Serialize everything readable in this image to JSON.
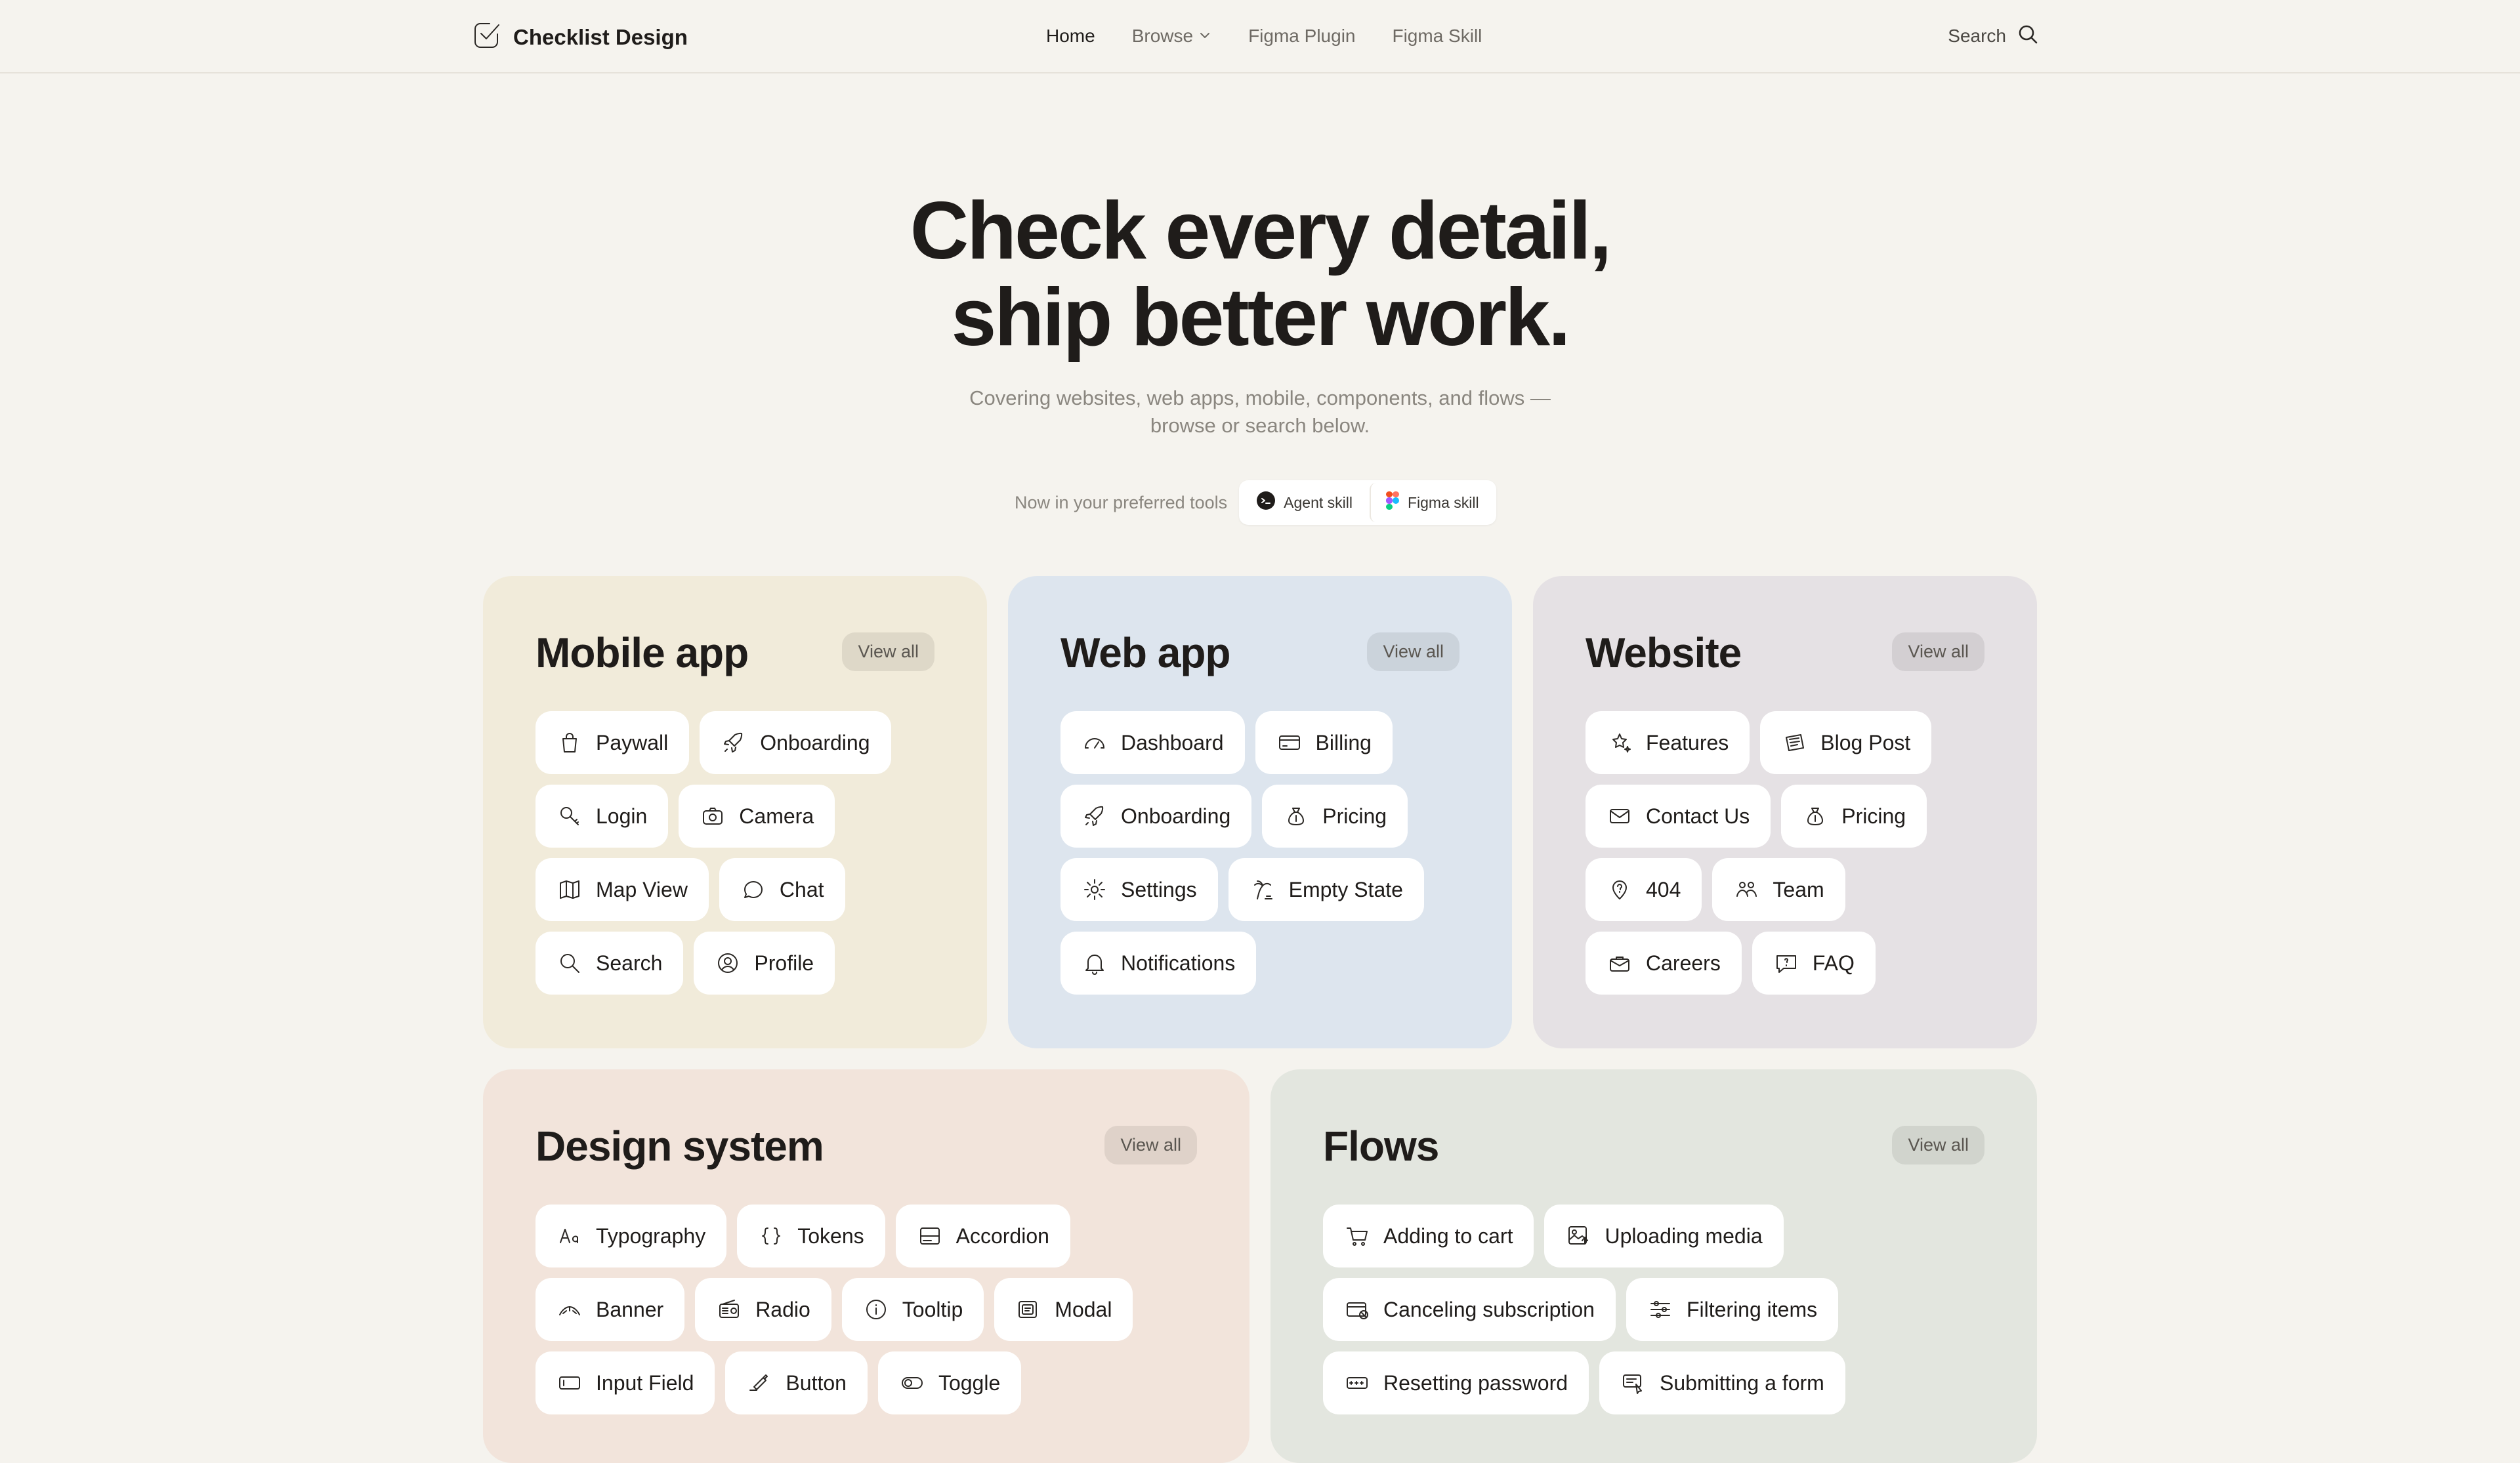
{
  "header": {
    "brand": "Checklist Design",
    "nav": [
      "Home",
      "Browse",
      "Figma Plugin",
      "Figma Skill"
    ],
    "search_label": "Search"
  },
  "hero": {
    "title_line1": "Check every detail,",
    "title_line2": "ship better work.",
    "subtitle_line1": "Covering websites, web apps, mobile, components, and flows —",
    "subtitle_line2": "browse or search below.",
    "tools_label": "Now in your preferred tools",
    "tools": [
      "Agent skill",
      "Figma skill"
    ]
  },
  "colors": {
    "background": "#f5f3ee",
    "mobile": "#f1ebda",
    "web": "#dde5ee",
    "website": "#e5e1e4",
    "design": "#f2e4db",
    "flows": "#e3e6df"
  },
  "cards": {
    "mobile": {
      "title": "Mobile app",
      "view_all": "View all",
      "rows": [
        [
          {
            "label": "Paywall",
            "icon": "bag-icon"
          },
          {
            "label": "Onboarding",
            "icon": "rocket-icon"
          }
        ],
        [
          {
            "label": "Login",
            "icon": "key-icon"
          },
          {
            "label": "Camera",
            "icon": "camera-icon"
          }
        ],
        [
          {
            "label": "Map View",
            "icon": "map-icon"
          },
          {
            "label": "Chat",
            "icon": "chat-icon"
          }
        ],
        [
          {
            "label": "Search",
            "icon": "search-icon"
          },
          {
            "label": "Profile",
            "icon": "profile-icon"
          }
        ]
      ]
    },
    "web": {
      "title": "Web app",
      "view_all": "View all",
      "rows": [
        [
          {
            "label": "Dashboard",
            "icon": "gauge-icon"
          },
          {
            "label": "Billing",
            "icon": "card-icon"
          }
        ],
        [
          {
            "label": "Onboarding",
            "icon": "rocket-icon"
          },
          {
            "label": "Pricing",
            "icon": "moneybag-icon"
          }
        ],
        [
          {
            "label": "Settings",
            "icon": "gear-icon"
          },
          {
            "label": "Empty State",
            "icon": "palm-icon"
          }
        ],
        [
          {
            "label": "Notifications",
            "icon": "bell-icon"
          }
        ]
      ]
    },
    "website": {
      "title": "Website",
      "view_all": "View all",
      "rows": [
        [
          {
            "label": "Features",
            "icon": "stars-icon"
          },
          {
            "label": "Blog Post",
            "icon": "newspaper-icon"
          }
        ],
        [
          {
            "label": "Contact Us",
            "icon": "mail-icon"
          },
          {
            "label": "Pricing",
            "icon": "moneybag-icon"
          }
        ],
        [
          {
            "label": "404",
            "icon": "lost-pin-icon"
          },
          {
            "label": "Team",
            "icon": "team-icon"
          }
        ],
        [
          {
            "label": "Careers",
            "icon": "briefcase-mail-icon"
          },
          {
            "label": "FAQ",
            "icon": "help-bubble-icon"
          }
        ]
      ]
    },
    "design": {
      "title": "Design system",
      "view_all": "View all",
      "rows": [
        [
          {
            "label": "Typography",
            "icon": "type-icon"
          },
          {
            "label": "Tokens",
            "icon": "braces-icon"
          },
          {
            "label": "Accordion",
            "icon": "accordion-icon"
          }
        ],
        [
          {
            "label": "Banner",
            "icon": "banner-icon"
          },
          {
            "label": "Radio",
            "icon": "radio-icon"
          },
          {
            "label": "Tooltip",
            "icon": "info-icon"
          },
          {
            "label": "Modal",
            "icon": "modal-icon"
          }
        ],
        [
          {
            "label": "Input Field",
            "icon": "input-icon"
          },
          {
            "label": "Button",
            "icon": "button-icon"
          },
          {
            "label": "Toggle",
            "icon": "toggle-icon"
          }
        ]
      ]
    },
    "flows": {
      "title": "Flows",
      "view_all": "View all",
      "rows": [
        [
          {
            "label": "Adding to cart",
            "icon": "cart-icon"
          },
          {
            "label": "Uploading media",
            "icon": "image-upload-icon"
          }
        ],
        [
          {
            "label": "Canceling subscription",
            "icon": "card-cancel-icon"
          },
          {
            "label": "Filtering items",
            "icon": "sliders-icon"
          }
        ],
        [
          {
            "label": "Resetting password",
            "icon": "password-icon"
          },
          {
            "label": "Submitting a form",
            "icon": "form-submit-icon"
          }
        ]
      ]
    }
  }
}
